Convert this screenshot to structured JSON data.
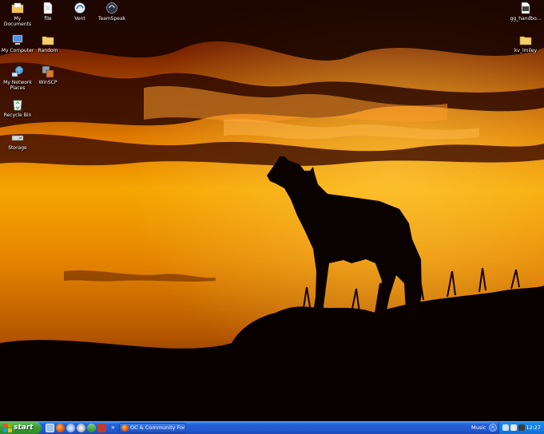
{
  "desktop": {
    "icons": [
      {
        "name": "desktop-icon-my-documents",
        "icon": "folder-documents-icon",
        "label": "My Documents"
      },
      {
        "name": "desktop-icon-file",
        "icon": "file-icon",
        "label": "file"
      },
      {
        "name": "desktop-icon-vent",
        "icon": "vent-icon",
        "label": "Vent"
      },
      {
        "name": "desktop-icon-teamspeak",
        "icon": "teamspeak-icon",
        "label": "TeamSpeak"
      },
      {
        "name": "desktop-icon-my-computer",
        "icon": "computer-icon",
        "label": "My Computer"
      },
      {
        "name": "desktop-icon-random",
        "icon": "folder-icon",
        "label": "Random"
      },
      {
        "name": "desktop-icon-my-network-places",
        "icon": "network-icon",
        "label": "My Network Places"
      },
      {
        "name": "desktop-icon-winscp",
        "icon": "winscp-icon",
        "label": "WinSCP"
      },
      {
        "name": "desktop-icon-recycle-bin",
        "icon": "recycle-bin-icon",
        "label": "Recycle Bin"
      },
      {
        "name": "desktop-icon-storage",
        "icon": "drive-icon",
        "label": "Storage"
      },
      {
        "name": "desktop-icon-gg-handbook",
        "icon": "document-icon",
        "label": "gg_handbo..."
      },
      {
        "name": "desktop-icon-kv-lmiley",
        "icon": "folder-icon",
        "label": "kv_lmiley"
      }
    ]
  },
  "taskbar": {
    "start_label": "start",
    "quick_launch": [
      "show-desktop-icon",
      "firefox-icon",
      "browser-icon",
      "media-player-icon",
      "messenger-icon",
      "app-icon"
    ],
    "chevron": "»",
    "task_button_label": "OC & Community For...",
    "toolbar_label": "Music",
    "tray_chevron": "«",
    "clock": "12:27"
  },
  "colors": {
    "taskbar_blue": "#2157d0",
    "start_green": "#3a9b35",
    "tray_blue": "#1270d8",
    "sky_orange": "#f5a000"
  }
}
